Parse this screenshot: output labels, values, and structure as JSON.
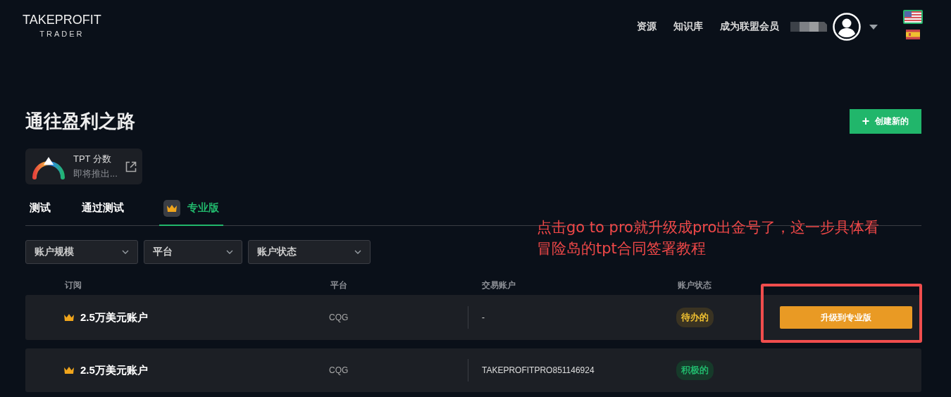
{
  "logo": {
    "wordmark": "TAKE**PROFIT**",
    "subtitle": "TRADER"
  },
  "nav": [
    "资源",
    "知识库",
    "成为联盟会员"
  ],
  "languages": [
    {
      "kind": "us",
      "selected": true
    },
    {
      "kind": "es",
      "selected": false
    }
  ],
  "page_title": "通往盈利之路",
  "create_button": {
    "icon": "+",
    "label": "创建新的"
  },
  "score_card": {
    "title": "TPT 分数",
    "subtitle": "即将推出..."
  },
  "tabs": [
    {
      "label": "测试",
      "selected": false,
      "crown": false
    },
    {
      "label": "通过测试",
      "selected": false,
      "crown": false
    },
    {
      "label": "专业版",
      "selected": true,
      "crown": true
    }
  ],
  "filters": [
    {
      "label": "账户规模"
    },
    {
      "label": "平台"
    },
    {
      "label": "账户状态"
    }
  ],
  "table": {
    "columns": [
      "订阅",
      "平台",
      "交易账户",
      "账户状态"
    ],
    "rows": [
      {
        "subscription": "2.5万美元账户",
        "platform": "CQG",
        "account": "-",
        "status": "待办的",
        "kind": "pending",
        "action": "升级到专业版",
        "highlighted": true
      },
      {
        "subscription": "2.5万美元账户",
        "platform": "CQG",
        "account": "TAKEPROFITPRO851146924",
        "status": "积极的",
        "kind": "active",
        "highlighted": false
      }
    ]
  },
  "annotation": [
    "点击go to pro就升级成pro出金号了，这一步具体看",
    "冒险岛的tpt合同签署教程"
  ]
}
